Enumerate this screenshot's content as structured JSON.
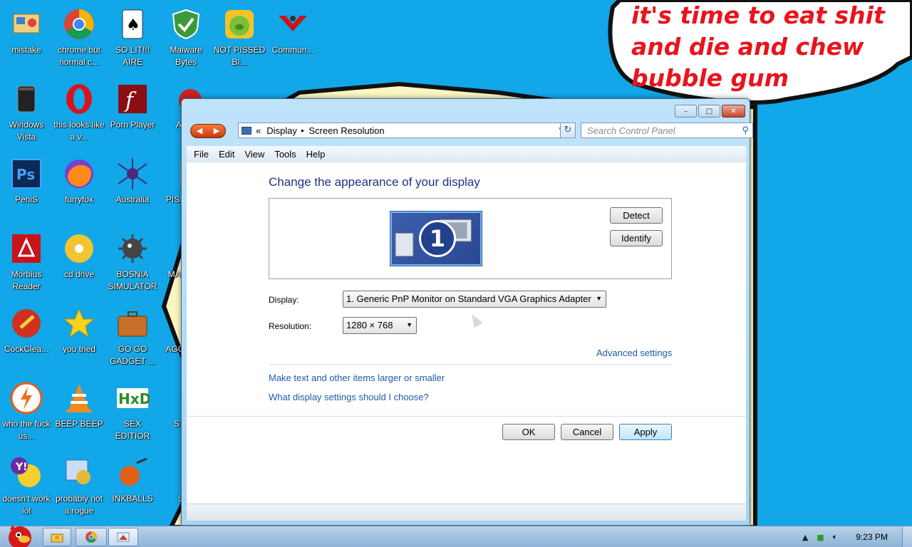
{
  "background": {
    "speech_bubble_text": "it's time to eat shit and die and chew bubble gum"
  },
  "desktop_icons": [
    {
      "label": "mistake"
    },
    {
      "label": "chrome but normal c..."
    },
    {
      "label": "SO LIT!!! AIRE"
    },
    {
      "label": "Malware Bytes"
    },
    {
      "label": "NOT PISSED BI..."
    },
    {
      "label": "Commun..."
    },
    {
      "label": "Windows Vista"
    },
    {
      "label": "this looks like a v..."
    },
    {
      "label": "Porn Player"
    },
    {
      "label": "AN B"
    },
    {
      "label": "PeniS"
    },
    {
      "label": "furryfox"
    },
    {
      "label": "Australia"
    },
    {
      "label": "PISS AVIA"
    },
    {
      "label": "Morbius Reader"
    },
    {
      "label": "cd drive"
    },
    {
      "label": "BOSNIA SIMULATOR"
    },
    {
      "label": "MAD UNI"
    },
    {
      "label": "CockClea..."
    },
    {
      "label": "you tried"
    },
    {
      "label": "GO GO GADGET ..."
    },
    {
      "label": "AGG GHO"
    },
    {
      "label": "who the fuck us..."
    },
    {
      "label": "BEEP BEEP"
    },
    {
      "label": "SEX EDITIOR"
    },
    {
      "label": "STA G"
    },
    {
      "label": "doesn't work lol"
    },
    {
      "label": "probably not a rogue"
    },
    {
      "label": "INKBALLS"
    },
    {
      "label": "STA"
    }
  ],
  "window": {
    "controls": {
      "minimize": "–",
      "maximize": "□",
      "close": "✕"
    },
    "nav": {
      "back": "◀",
      "forward": "▶"
    },
    "address": {
      "prefix": "«",
      "crumbs": [
        "Display",
        "Screen Resolution"
      ],
      "separator": "▸",
      "dropdown": "▾"
    },
    "refresh_icon": "↻",
    "search": {
      "placeholder": "Search Control Panel",
      "icon": "⚲"
    },
    "menu": [
      "File",
      "Edit",
      "View",
      "Tools",
      "Help"
    ],
    "title": "Change the appearance of your display",
    "monitor_number": "1",
    "detect_label": "Detect",
    "identify_label": "Identify",
    "display_label": "Display:",
    "display_value": "1. Generic PnP Monitor on Standard VGA Graphics Adapter",
    "resolution_label": "Resolution:",
    "resolution_value": "1280 × 768",
    "advanced_link": "Advanced settings",
    "link_text_size": "Make text and other items larger or smaller",
    "link_what_settings": "What display settings should I choose?",
    "ok_label": "OK",
    "cancel_label": "Cancel",
    "apply_label": "Apply"
  },
  "taskbar": {
    "clock": "9:23 PM",
    "tray_icons": [
      "show-hidden-icon",
      "network-icon",
      "volume-icon"
    ]
  }
}
